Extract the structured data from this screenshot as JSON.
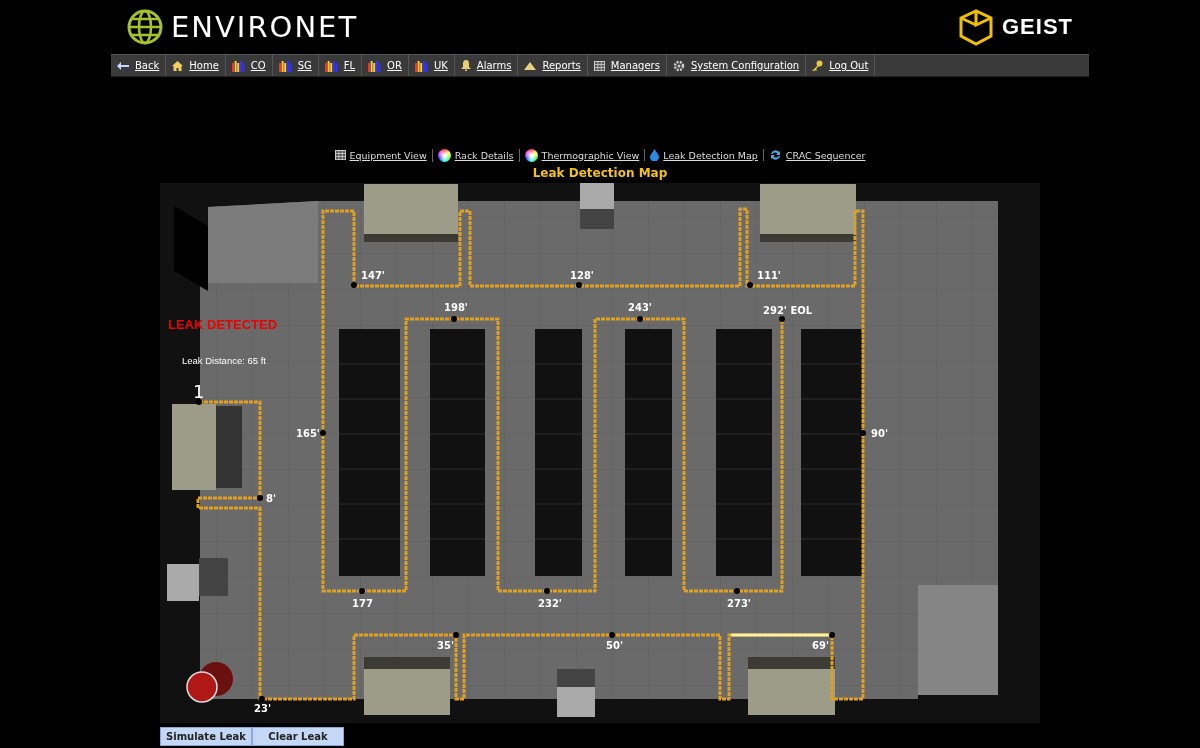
{
  "header": {
    "product_name": "ENVIRONET",
    "vendor_name": "GEIST"
  },
  "nav": [
    {
      "label": "Back",
      "kind": "back"
    },
    {
      "label": "Home",
      "kind": "home"
    },
    {
      "label": "CO",
      "kind": "site"
    },
    {
      "label": "SG",
      "kind": "site"
    },
    {
      "label": "FL",
      "kind": "site"
    },
    {
      "label": "OR",
      "kind": "site"
    },
    {
      "label": "UK",
      "kind": "site"
    },
    {
      "label": "Alarms",
      "kind": "alarm"
    },
    {
      "label": "Reports",
      "kind": "report"
    },
    {
      "label": "Managers",
      "kind": "grid"
    },
    {
      "label": "System Configuration",
      "kind": "gear"
    },
    {
      "label": "Log Out",
      "kind": "key"
    }
  ],
  "view_links": [
    {
      "label": "Equipment View",
      "kind": "grid"
    },
    {
      "label": "Rack Details",
      "kind": "wheel"
    },
    {
      "label": "Thermographic View",
      "kind": "wheel"
    },
    {
      "label": "Leak Detection Map",
      "kind": "drop"
    },
    {
      "label": "CRAC Sequencer",
      "kind": "cycle"
    }
  ],
  "page_title": "Leak Detection Map",
  "map": {
    "alert": "LEAK DETECTED",
    "leak_distance": "Leak Distance: 65 ft",
    "markers": [
      "147'",
      "128'",
      "111'",
      "198'",
      "243'",
      "292' EOL",
      "1",
      "165'",
      "90'",
      "8'",
      "177",
      "232'",
      "273'",
      "35'",
      "50'",
      "69'",
      "23'"
    ]
  },
  "buttons": [
    "Simulate Leak",
    "Clear Leak"
  ]
}
